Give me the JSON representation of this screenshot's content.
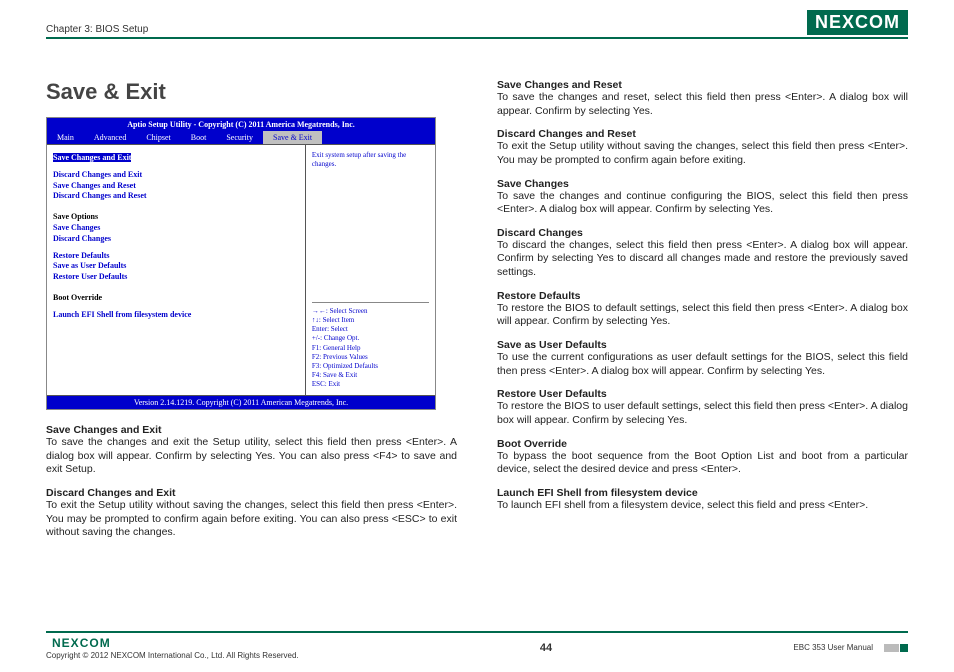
{
  "header": {
    "chapter": "Chapter 3: BIOS Setup",
    "logo": "NEXCOM"
  },
  "section_title": "Save & Exit",
  "bios": {
    "title_bar": "Aptio Setup Utility - Copyright (C) 2011 America Megatrends, Inc.",
    "footer_bar": "Version 2.14.1219. Copyright (C) 2011 American Megatrends, Inc.",
    "tabs": [
      "Main",
      "Advanced",
      "Chipset",
      "Boot",
      "Security",
      "Save & Exit"
    ],
    "active_tab": "Save & Exit",
    "left_groups": {
      "g1_hl": "Save Changes and Exit",
      "g1": [
        "Discard Changes and Exit",
        "Save Changes and Reset",
        "Discard Changes and Reset"
      ],
      "g2_head": "Save Options",
      "g2": [
        "Save Changes",
        "Discard Changes"
      ],
      "g3": [
        "Restore Defaults",
        "Save as User Defaults",
        "Restore User Defaults"
      ],
      "g4_head": "Boot Override",
      "g5": [
        "Launch EFI Shell from filesystem device"
      ]
    },
    "help_text": "Exit system setup after saving the changes.",
    "keys": [
      "→←: Select Screen",
      "↑↓: Select Item",
      "Enter: Select",
      "+/-: Change Opt.",
      "F1: General Help",
      "F2: Previous Values",
      "F3: Optimized Defaults",
      "F4: Save & Exit",
      "ESC: Exit"
    ]
  },
  "left_descs": [
    {
      "head": "Save Changes and Exit",
      "body": "To save the changes and exit the Setup utility, select this field then press <Enter>. A dialog box will appear. Confirm by selecting Yes. You can also press <F4> to save and exit Setup."
    },
    {
      "head": "Discard Changes and Exit",
      "body": "To exit the Setup utility without saving the changes, select this field then press <Enter>. You may be prompted to confirm again before exiting. You can also press <ESC> to exit without saving the changes."
    }
  ],
  "right_descs": [
    {
      "head": "Save Changes and Reset",
      "body": "To save the changes and reset, select this field then press <Enter>. A dialog box will appear. Confirm by selecting Yes."
    },
    {
      "head": "Discard Changes and Reset",
      "body": "To exit the Setup utility without saving the changes, select this field then press <Enter>. You may be prompted to confirm again before exiting."
    },
    {
      "head": "Save Changes",
      "body": "To save the changes and continue configuring the BIOS, select this field then press <Enter>. A dialog box will appear. Confirm by selecting Yes."
    },
    {
      "head": "Discard Changes",
      "body": "To discard the changes, select this field then press <Enter>. A dialog box will appear. Confirm by selecting Yes to discard all changes made and restore the previously saved settings."
    },
    {
      "head": "Restore Defaults",
      "body": "To restore the BIOS to default settings, select this field then press <Enter>. A dialog box will appear. Confirm by selecting Yes."
    },
    {
      "head": "Save as User Defaults",
      "body": "To use the current configurations as user default settings for the BIOS, select this field then press <Enter>. A dialog box will appear. Confirm by selecting Yes."
    },
    {
      "head": "Restore User Defaults",
      "body": "To restore the BIOS to user default settings, select this field then press <Enter>. A dialog box will appear. Confirm by selecing Yes."
    },
    {
      "head": "Boot Override",
      "body": "To bypass the boot sequence from the Boot Option List and boot from a particular device, select the desired device and press <Enter>."
    },
    {
      "head": "Launch EFI Shell from filesystem device",
      "body": "To launch EFI shell from a filesystem device, select this field and press <Enter>."
    }
  ],
  "footer": {
    "logo": "NEXCOM",
    "copyright": "Copyright © 2012 NEXCOM International Co., Ltd. All Rights Reserved.",
    "page": "44",
    "manual": "EBC 353 User Manual"
  }
}
